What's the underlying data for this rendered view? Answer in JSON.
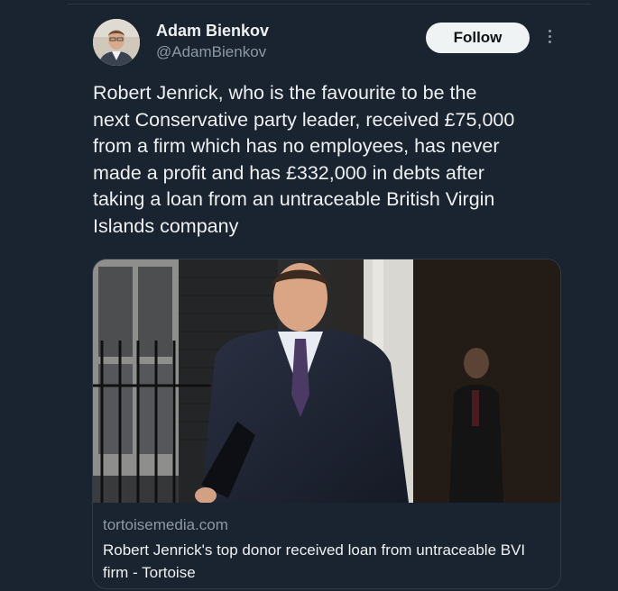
{
  "tweet": {
    "author_name": "Adam Bienkov",
    "author_handle": "@AdamBienkov",
    "follow_label": "Follow",
    "text": "Robert Jenrick, who is the favourite to be the\nnext Conservative party leader, received £75,000\nfrom a firm which has no employees, has never\nmade a profit and has £332,000 in debts after\ntaking a loan from an untraceable British Virgin\nIslands company"
  },
  "link_card": {
    "domain": "tortoisemedia.com",
    "title": "Robert Jenrick's top donor received loan from untraceable BVI firm - Tortoise"
  },
  "icons": {
    "more": "more-vertical-icon"
  },
  "colors": {
    "background": "#1a2430",
    "follow_button_bg": "#eff3f4",
    "secondary_text": "#8b98a5"
  }
}
